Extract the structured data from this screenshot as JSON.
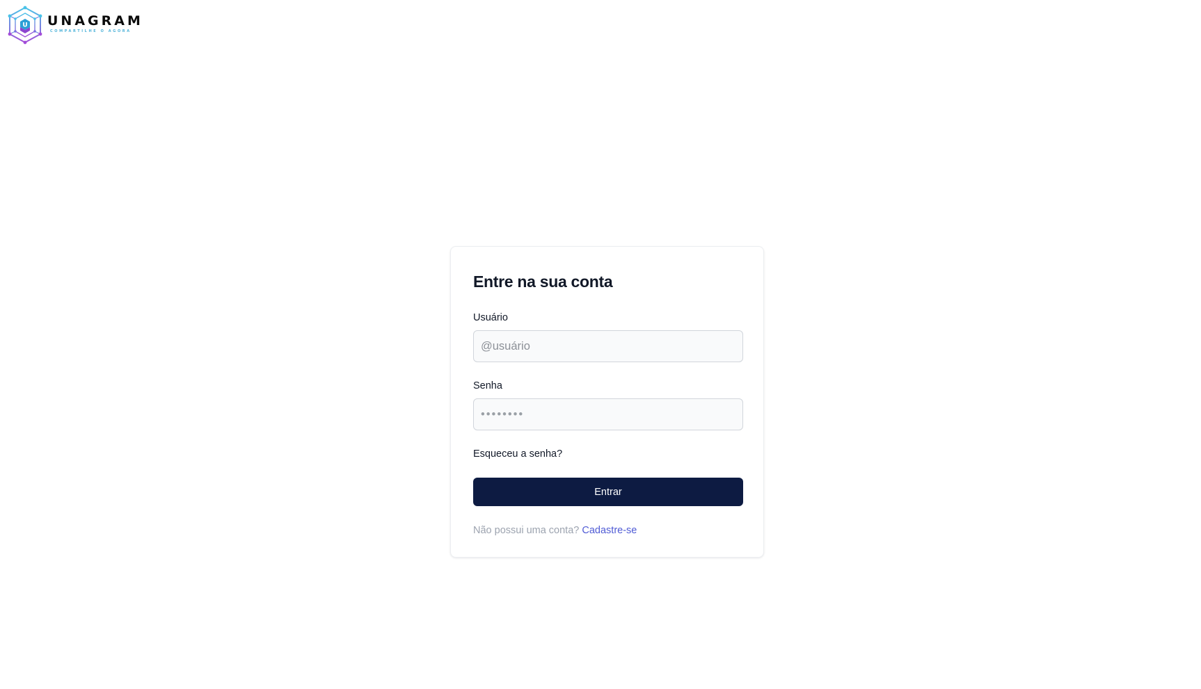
{
  "brand": {
    "name": "UNAGRAM",
    "tagline": "COMPARTILHE O AGORA",
    "mark_letter": "U"
  },
  "login": {
    "title": "Entre na sua conta",
    "username_label": "Usuário",
    "username_placeholder": "@usuário",
    "username_value": "",
    "password_label": "Senha",
    "password_placeholder": "••••••••",
    "password_value": "",
    "forgot_password": "Esqueceu a senha?",
    "submit_label": "Entrar",
    "signup_prompt": "Não possui uma conta?",
    "signup_link": "Cadastre-se"
  },
  "colors": {
    "primary_button": "#0d1b42",
    "link": "#4f5bd5",
    "logo_cyan": "#4fb3d9",
    "logo_purple": "#9b4fd6"
  },
  "icons": {
    "logo": "hexagon-network-logo-icon"
  }
}
